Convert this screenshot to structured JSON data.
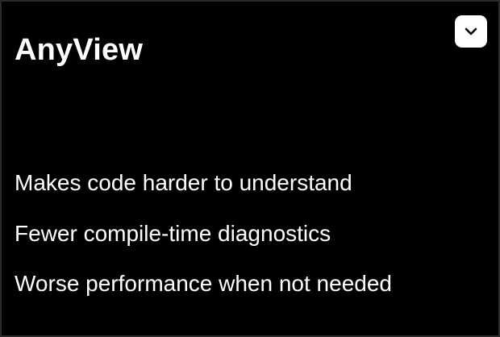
{
  "card": {
    "title": "AnyView",
    "toggle_icon": "chevron-down-icon",
    "points": [
      "Makes code harder to understand",
      "Fewer compile-time diagnostics",
      "Worse performance when not needed"
    ]
  },
  "colors": {
    "background": "#000000",
    "text": "#ffffff",
    "toggle_background": "#ffffff",
    "toggle_icon": "#000000"
  }
}
